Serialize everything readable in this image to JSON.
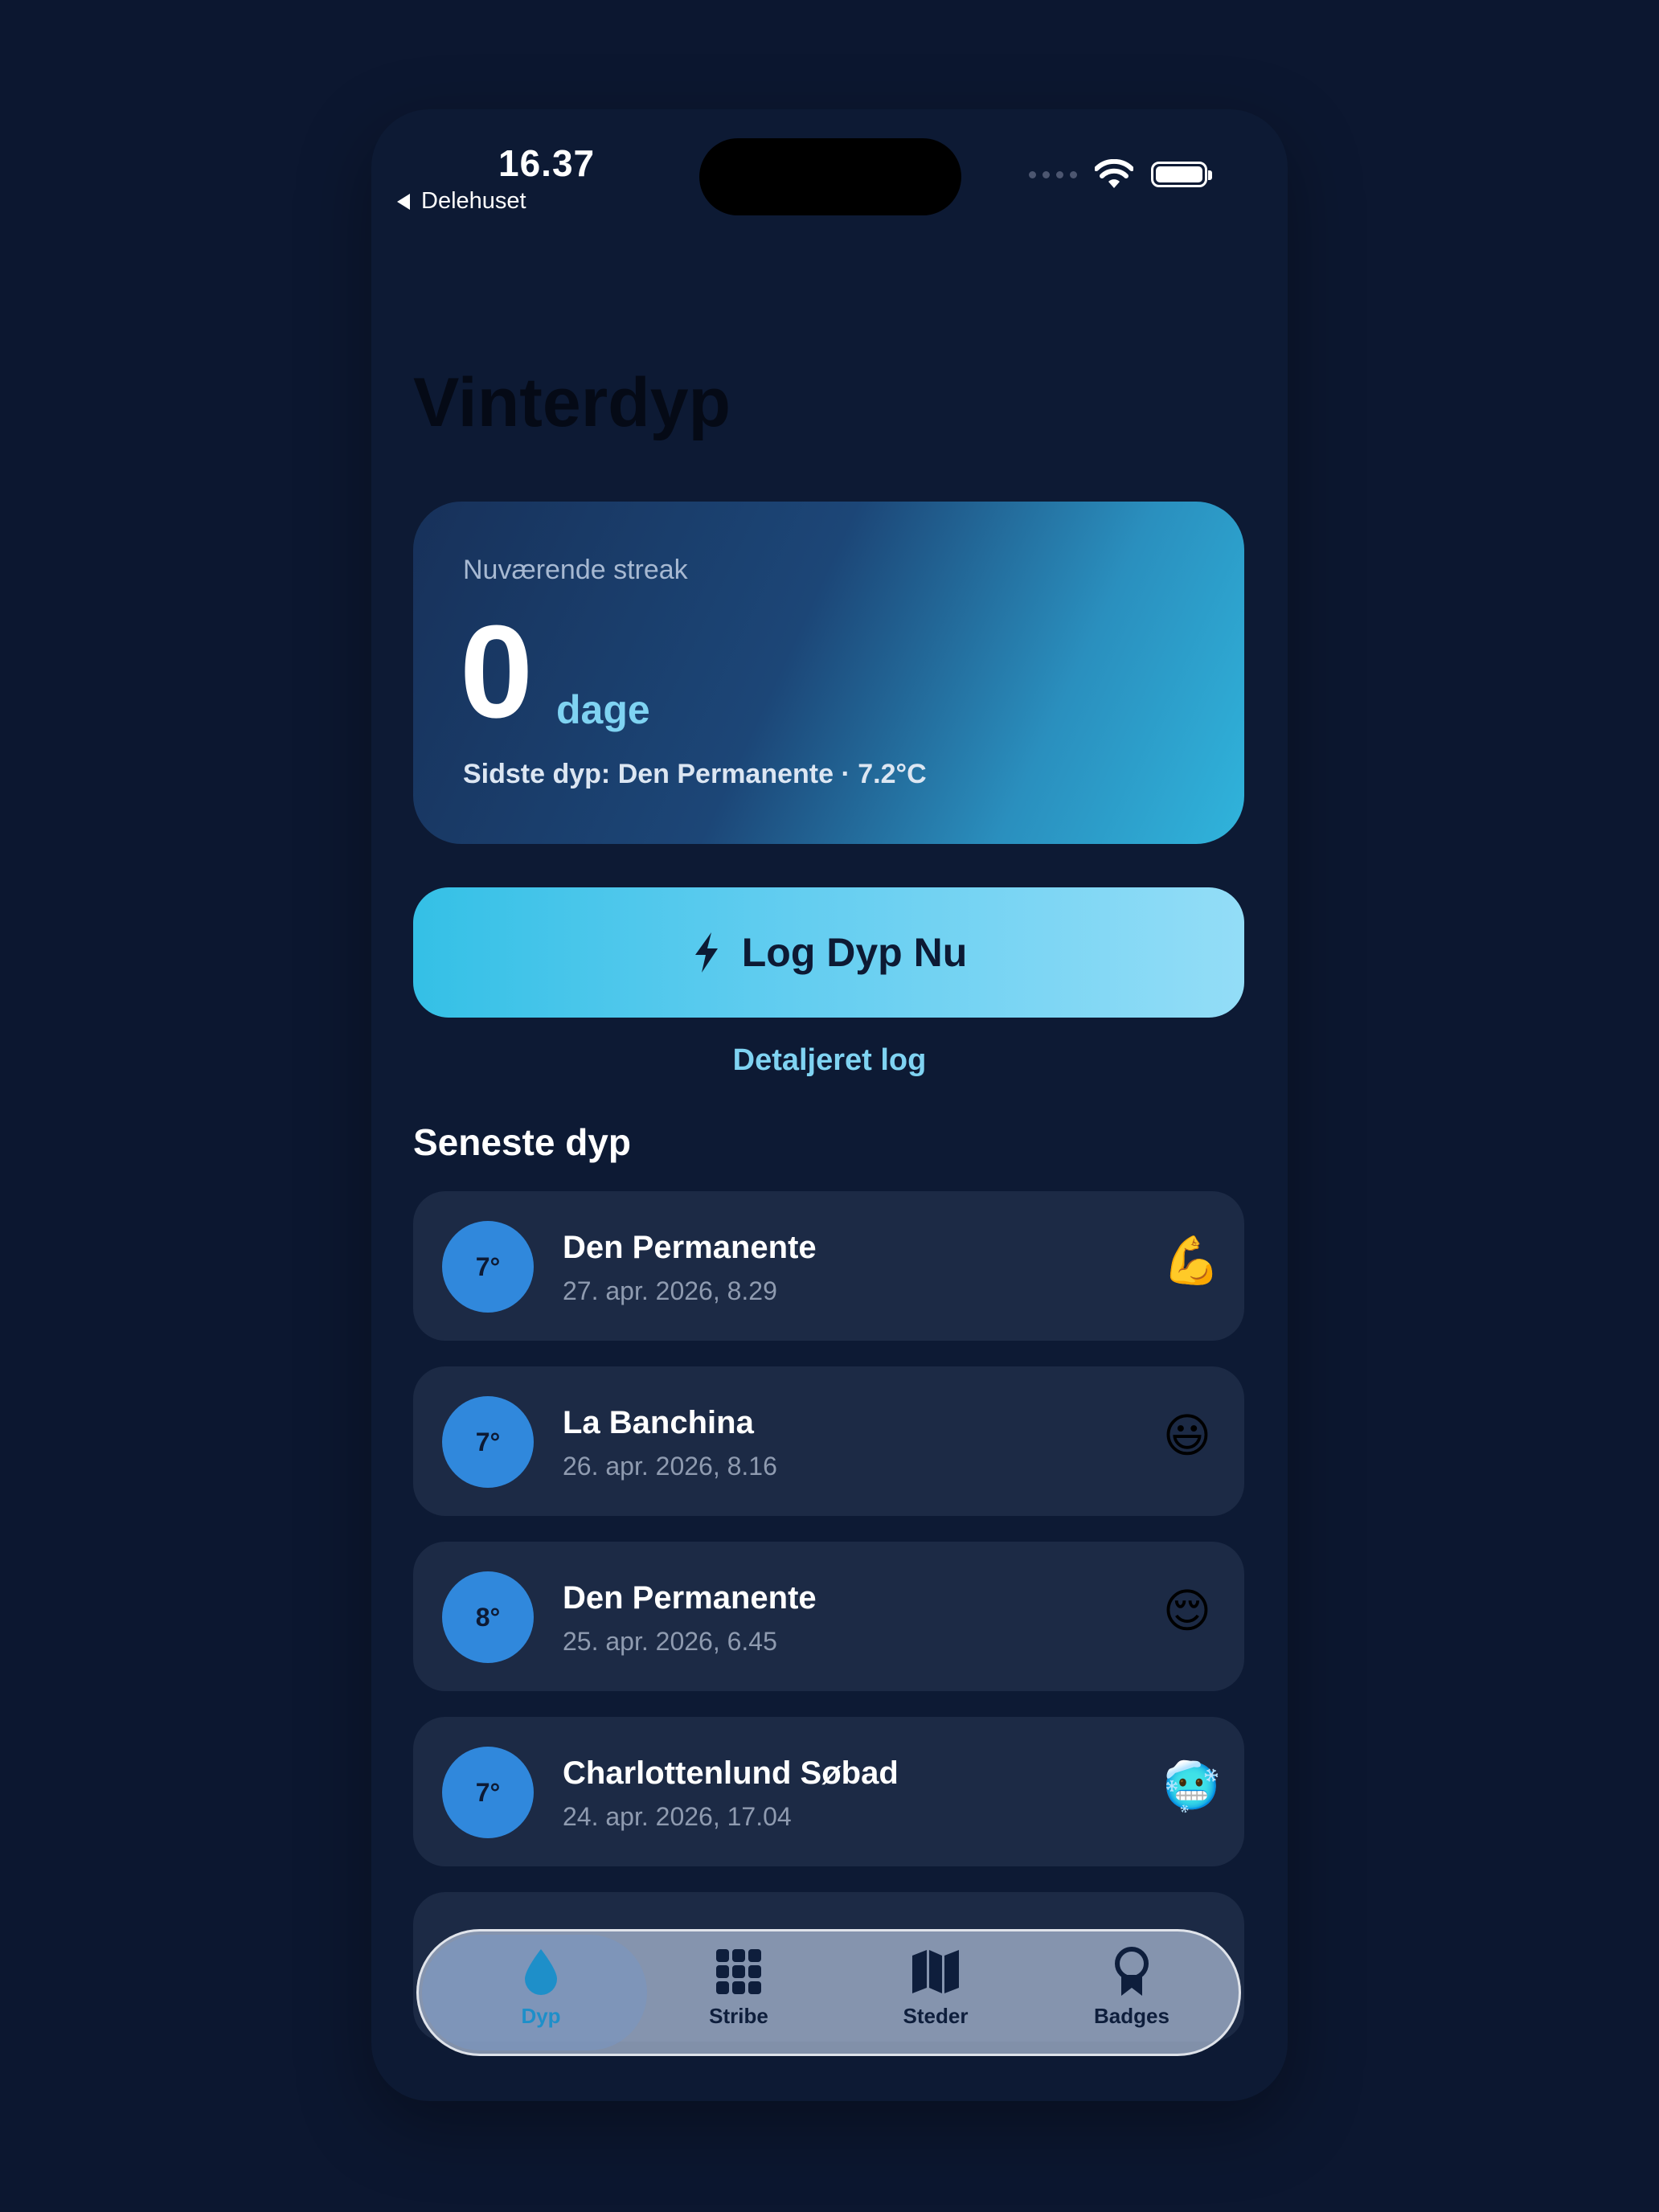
{
  "status_bar": {
    "time": "16.37",
    "back_label": "Delehuset"
  },
  "page": {
    "title": "Vinterdyp"
  },
  "streak_card": {
    "label": "Nuværende streak",
    "value": "0",
    "unit": "dage",
    "last_dip": "Sidste dyp: Den Permanente · 7.2°C"
  },
  "log_button": {
    "label": "Log Dyp Nu",
    "icon": "bolt-icon"
  },
  "detail_link": "Detaljeret log",
  "recent_section": {
    "title": "Seneste dyp",
    "items": [
      {
        "temp": "7°",
        "place": "Den Permanente",
        "date": "27. apr. 2026, 8.29",
        "emoji": "💪"
      },
      {
        "temp": "7°",
        "place": "La Banchina",
        "date": "26. apr. 2026, 8.16",
        "emoji": "😃"
      },
      {
        "temp": "8°",
        "place": "Den Permanente",
        "date": "25. apr. 2026, 6.45",
        "emoji": "😌"
      },
      {
        "temp": "7°",
        "place": "Charlottenlund Søbad",
        "date": "24. apr. 2026, 17.04",
        "emoji": "🥶"
      }
    ]
  },
  "tab_bar": {
    "tabs": [
      {
        "label": "Dyp",
        "icon": "water-drop-icon",
        "active": true
      },
      {
        "label": "Stribe",
        "icon": "grid-icon",
        "active": false
      },
      {
        "label": "Steder",
        "icon": "map-icon",
        "active": false
      },
      {
        "label": "Badges",
        "icon": "ribbon-badge-icon",
        "active": false
      }
    ]
  },
  "colors": {
    "background": "#0c1730",
    "card": "#1c2a45",
    "accent": "#7fd3f2",
    "temp_circle": "#3088dc",
    "active_tab": "#1e8fc9"
  }
}
